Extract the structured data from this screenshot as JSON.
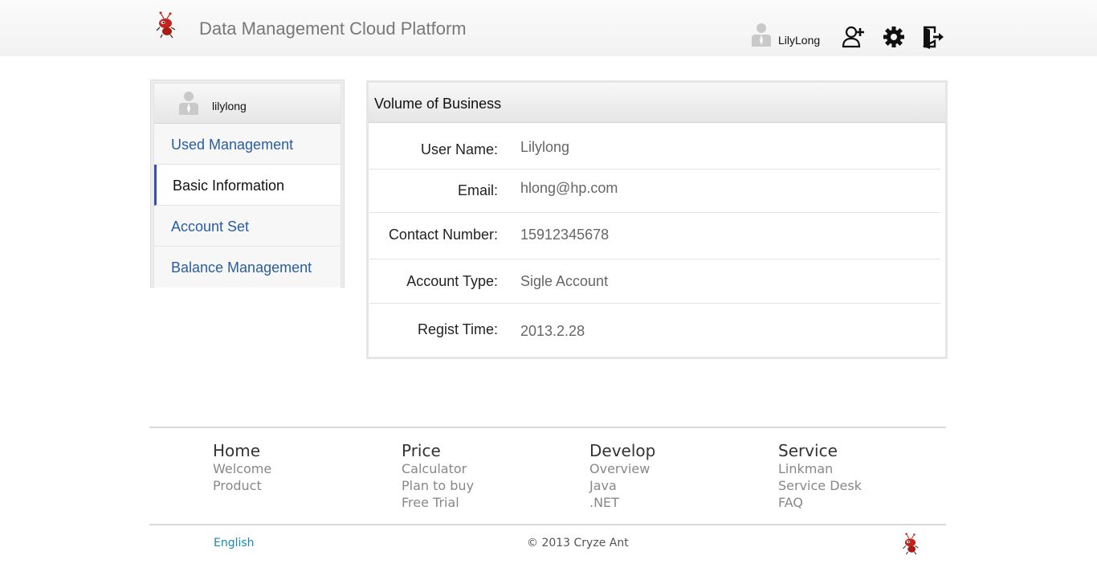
{
  "header": {
    "title": "Data Management Cloud Platform",
    "username": "LilyLong",
    "icons": [
      "logo-icon",
      "user-avatar-icon",
      "add-user-icon",
      "gear-icon",
      "exit-icon"
    ]
  },
  "sidebar": {
    "username": "lilylong",
    "items": [
      {
        "label": "Used Management",
        "active": false
      },
      {
        "label": "Basic Information",
        "active": true
      },
      {
        "label": "Account Set",
        "active": false
      },
      {
        "label": "Balance Management",
        "active": false
      }
    ]
  },
  "main": {
    "title": "Volume of Business",
    "fields": [
      {
        "label": "User Name:",
        "value": "Lilylong"
      },
      {
        "label": "Email:",
        "value": "hlong@hp.com"
      },
      {
        "label": "Contact Number:",
        "value": "15912345678"
      },
      {
        "label": "Account Type:",
        "value": "Sigle Account"
      },
      {
        "label": "Regist Time:",
        "value": "2013.2.28"
      }
    ]
  },
  "footer": {
    "columns": [
      {
        "heading": "Home",
        "links": [
          "Welcome",
          "Product"
        ]
      },
      {
        "heading": "Price",
        "links": [
          "Calculator",
          "Plan to buy",
          "Free Trial"
        ]
      },
      {
        "heading": "Develop",
        "links": [
          "Overview",
          "Java",
          ".NET"
        ]
      },
      {
        "heading": "Service",
        "links": [
          "Linkman",
          "Service Desk",
          "FAQ"
        ]
      }
    ],
    "language": "English",
    "copyright": "© 2013 Cryze Ant"
  },
  "colors": {
    "link_blue": "#2a5d9f",
    "active_marker": "#3a4db3",
    "logo_red": "#c0241c",
    "footer_lang": "#1a8ab0"
  }
}
